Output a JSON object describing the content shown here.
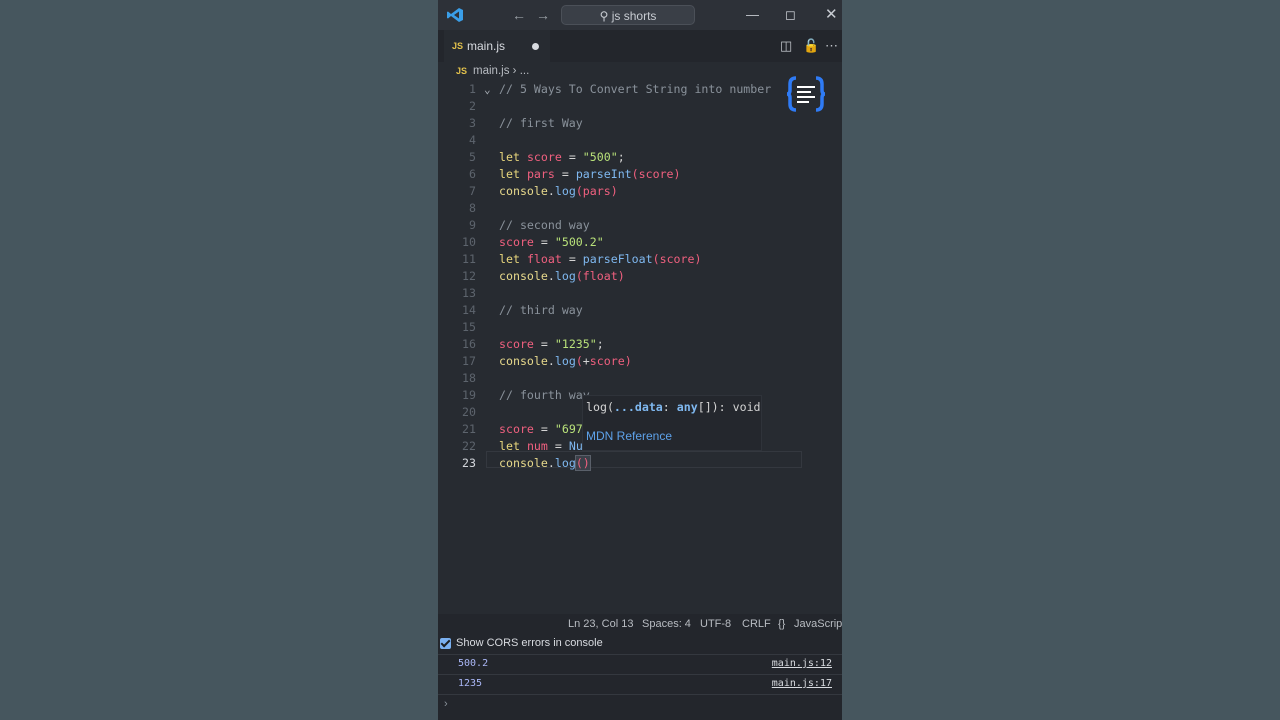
{
  "titlebar": {
    "search": "js shorts",
    "back_icon": "arrow-left-icon",
    "forward_icon": "arrow-right-icon",
    "minimize_icon": "minimize-icon",
    "maximize_icon": "maximize-icon",
    "close_icon": "close-icon"
  },
  "tab": {
    "badge": "JS",
    "label": "main.js"
  },
  "breadcrumb": {
    "badge": "JS",
    "file": "main.js",
    "sep": "›",
    "rest": "..."
  },
  "code_lines": [
    {
      "n": "1"
    },
    {
      "n": "2"
    },
    {
      "n": "3"
    },
    {
      "n": "4"
    },
    {
      "n": "5"
    },
    {
      "n": "6"
    },
    {
      "n": "7"
    },
    {
      "n": "8"
    },
    {
      "n": "9"
    },
    {
      "n": "10"
    },
    {
      "n": "11"
    },
    {
      "n": "12"
    },
    {
      "n": "13"
    },
    {
      "n": "14"
    },
    {
      "n": "15"
    },
    {
      "n": "16"
    },
    {
      "n": "17"
    },
    {
      "n": "18"
    },
    {
      "n": "19"
    },
    {
      "n": "20"
    },
    {
      "n": "21"
    },
    {
      "n": "22"
    },
    {
      "n": "23"
    }
  ],
  "code": {
    "l1": "// 5 Ways To Convert String into number",
    "l3": "// first Way",
    "l5_kw": "let",
    "l5_var": "score",
    "l5_op": " = ",
    "l5_str": "\"500\"",
    "l5_end": ";",
    "l6_kw": "let",
    "l6_var": "pars",
    "l6_op": " = ",
    "l6_fn": "parseInt",
    "l6_arg": "score",
    "l7_obj": "console",
    "l7_meth": "log",
    "l7_arg": "pars",
    "l9": "// second way",
    "l10_var": "score",
    "l10_op": " = ",
    "l10_str": "\"500.2\"",
    "l11_kw": "let",
    "l11_var": "float",
    "l11_op": " = ",
    "l11_fn": "parseFloat",
    "l11_arg": "score",
    "l12_obj": "console",
    "l12_meth": "log",
    "l12_arg": "float",
    "l14": "// third way",
    "l16_var": "score",
    "l16_op": " = ",
    "l16_str": "\"1235\"",
    "l16_end": ";",
    "l17_obj": "console",
    "l17_meth": "log",
    "l17_plus": "+",
    "l17_arg": "score",
    "l19": "// fourth way",
    "l21_var": "score",
    "l21_op": " = ",
    "l21_str": "\"697",
    "l22_kw": "let",
    "l22_var": "num",
    "l22_op": " = ",
    "l22_fn": "Nu",
    "l23_obj": "console",
    "l23_meth": "log"
  },
  "hover": {
    "sig_pre": "log(",
    "sig_param": "...data",
    "sig_colon": ": ",
    "sig_type": "any",
    "sig_post": "[]): void",
    "link": "MDN Reference"
  },
  "status": {
    "position": "Ln 23, Col 13",
    "spaces": "Spaces: 4",
    "encoding": "UTF-8",
    "eol": "CRLF",
    "language_icon": "{}",
    "language": "JavaScript"
  },
  "console": {
    "cors_label": "Show CORS errors in console",
    "logs": [
      {
        "value": "500.2",
        "source": "main.js:12"
      },
      {
        "value": "1235",
        "source": "main.js:17"
      }
    ],
    "prompt": "›"
  },
  "colors": {
    "editor_bg": "#272b31",
    "string": "#b9e27a",
    "keyword": "#e9d77d",
    "variable": "#f0607f",
    "method": "#7fb8f0",
    "comment": "#8a929b"
  }
}
